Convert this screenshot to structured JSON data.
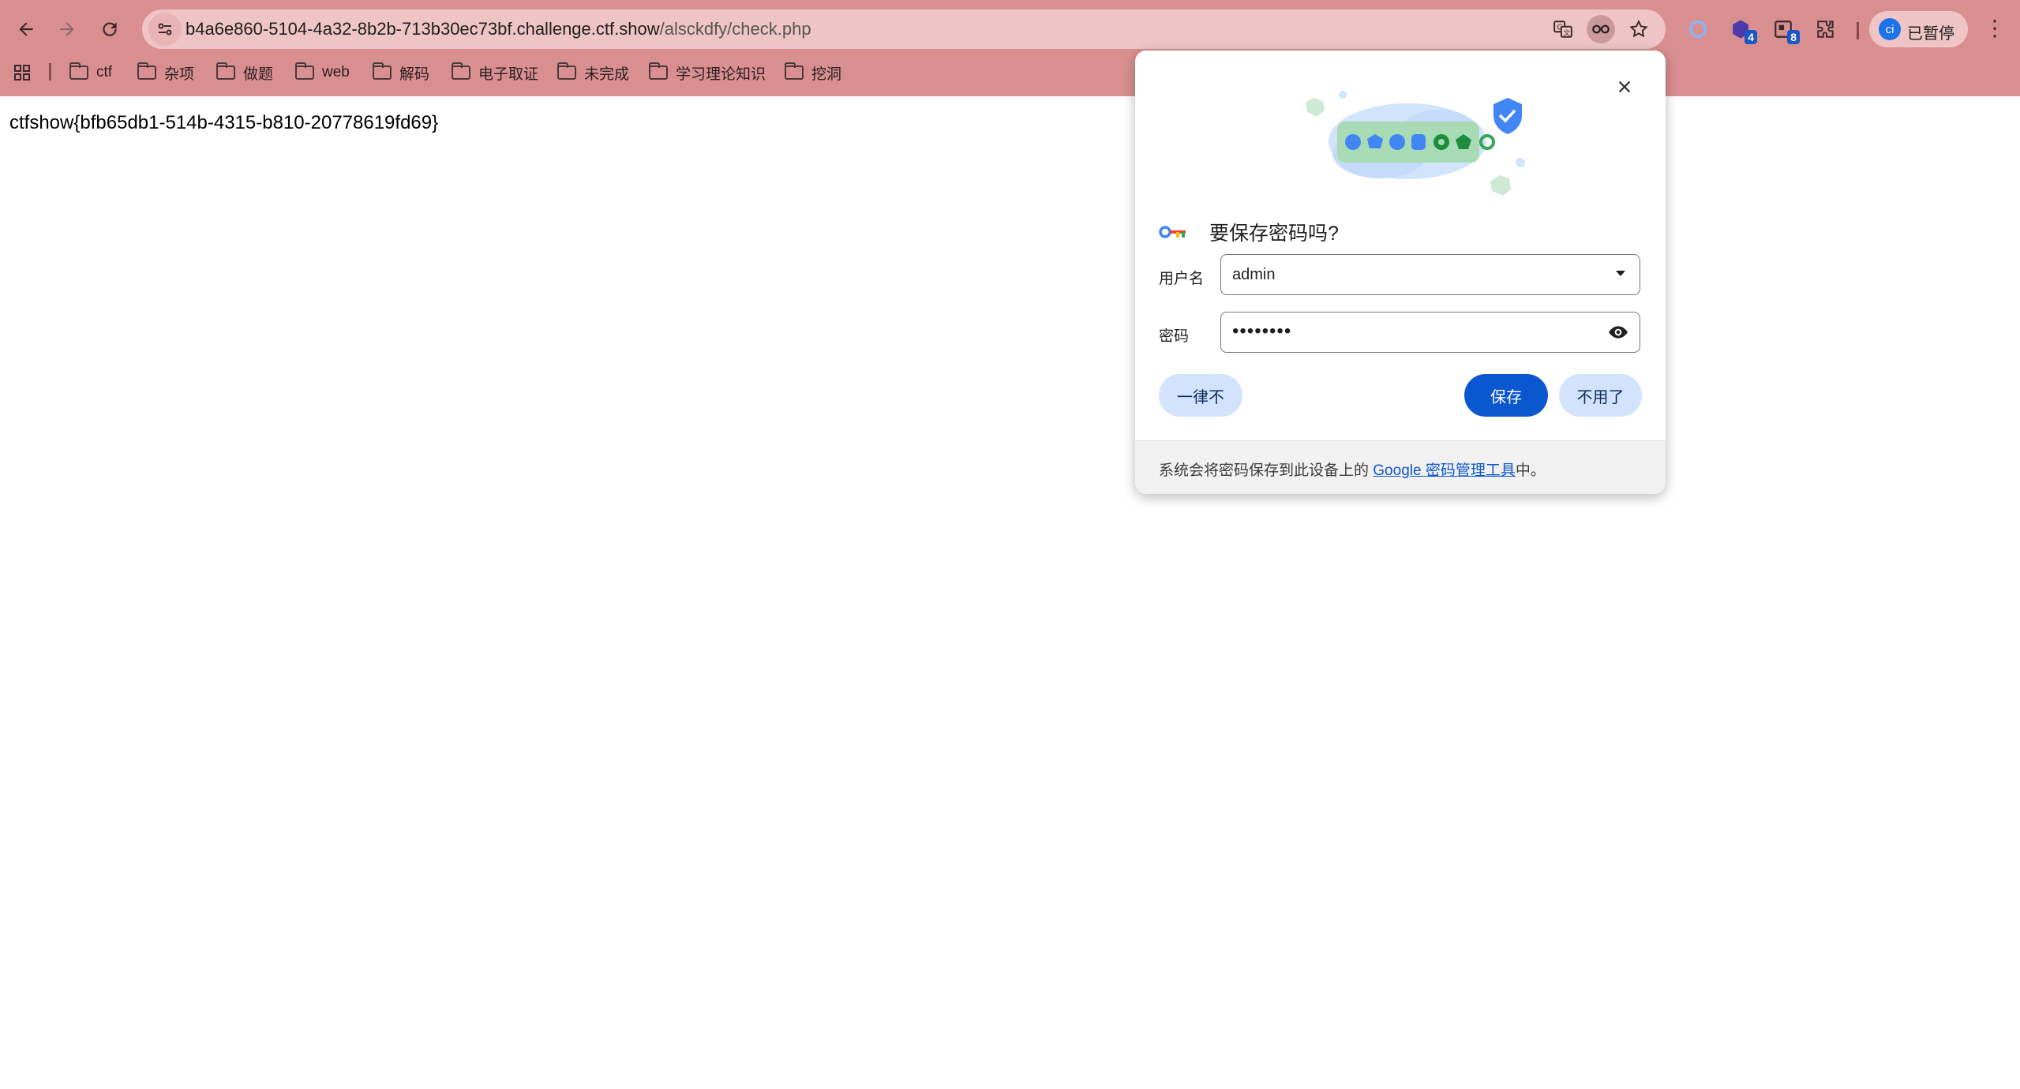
{
  "browser": {
    "address_url_host": "b4a6e860-5104-4a32-8b2b-713b30ec73bf.challenge.ctf.show",
    "address_url_path": "/alsckdfy/check.php",
    "extension_badges": [
      "4",
      "8"
    ],
    "profile_initial": "ci",
    "profile_status": "已暂停",
    "accent_color": "#d98f90"
  },
  "bookmarks": [
    {
      "label": "ctf"
    },
    {
      "label": "杂项"
    },
    {
      "label": "做题"
    },
    {
      "label": "web"
    },
    {
      "label": "解码"
    },
    {
      "label": "电子取证"
    },
    {
      "label": "未完成"
    },
    {
      "label": "学习理论知识"
    },
    {
      "label": "挖洞"
    }
  ],
  "page": {
    "flag_text": "ctfshow{bfb65db1-514b-4315-b810-20778619fd69}"
  },
  "dialog": {
    "title": "要保存密码吗?",
    "username_label": "用户名",
    "username_value": "admin",
    "password_label": "密码",
    "password_masked": "••••••••",
    "never_button": "一律不",
    "save_button": "保存",
    "no_thanks_button": "不用了",
    "footer_prefix": "系统会将密码保存到此设备上的 ",
    "footer_link": "Google 密码管理工具",
    "footer_suffix": "中。",
    "primary_color": "#0b57d0",
    "tonal_color": "#d3e3fd"
  }
}
